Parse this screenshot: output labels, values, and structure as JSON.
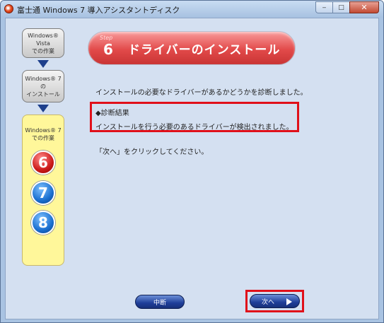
{
  "window": {
    "title": "富士通 Windows 7 導入アシスタントディスク",
    "controls": {
      "minimize": "‒",
      "maximize": "□",
      "close": "✕"
    }
  },
  "sidebar": {
    "step1": {
      "line1": "Windows® Vista",
      "line2": "での作業"
    },
    "step2": {
      "line1": "Windows® 7 の",
      "line2": "インストール"
    },
    "step3": {
      "line1": "Windows® 7",
      "line2": "での作業"
    },
    "circles": [
      "6",
      "7",
      "8"
    ]
  },
  "header": {
    "step_label": "Step",
    "step_number": "6",
    "title": "ドライバーのインストール"
  },
  "main": {
    "intro": "インストールの必要なドライバーがあるかどうかを診断しました。",
    "result_heading": "◆診断結果",
    "result_text": "インストールを行う必要のあるドライバーが検出されました。",
    "instruction": "「次へ」をクリックしてください。"
  },
  "buttons": {
    "stop": "中断",
    "next": "次へ"
  },
  "colors": {
    "banner": "#e24a4a",
    "highlight": "#e0101a",
    "button": "#1f3e99",
    "client_bg": "#d4e0f1"
  }
}
